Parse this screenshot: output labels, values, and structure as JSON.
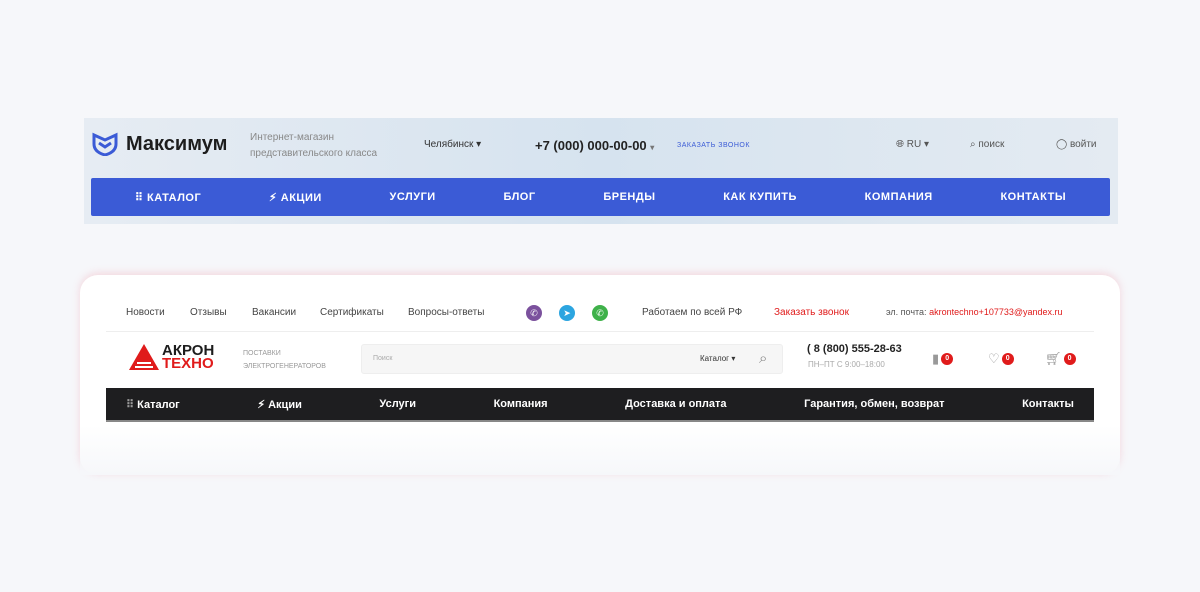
{
  "maximum": {
    "logo": "Максимум",
    "tagline": [
      "Интернет-магазин",
      "представительского класса"
    ],
    "city": "Челябинск",
    "phone": "+7 (000) 000-00-00",
    "callback": "ЗАКАЗАТЬ ЗВОНОК",
    "lang": "RU",
    "search": "поиск",
    "login": "войти",
    "nav": [
      "КАТАЛОГ",
      "АКЦИИ",
      "УСЛУГИ",
      "БЛОГ",
      "БРЕНДЫ",
      "КАК КУПИТЬ",
      "КОМПАНИЯ",
      "КОНТАКТЫ"
    ],
    "accent": "#3b5bd6"
  },
  "akron": {
    "top_links": [
      "Новости",
      "Отзывы",
      "Вакансии",
      "Сертификаты",
      "Вопросы-ответы"
    ],
    "region": "Работаем по всей РФ",
    "callback": "Заказать звонок",
    "email_label": "эл. почта:",
    "email": "akrontechno+107733@yandex.ru",
    "logo": [
      "АКРОН",
      "ТЕХНО"
    ],
    "tagline": [
      "ПОСТАВКИ",
      "ЭЛЕКТРОГЕНЕРАТОРОВ"
    ],
    "search_placeholder": "Поиск",
    "search_catalog": "Каталог",
    "phone": "8 (800) 555-28-63",
    "hours": "ПН–ПТ С 9:00–18:00",
    "compare_count": "0",
    "favorites_count": "0",
    "cart_count": "0",
    "nav": [
      "Каталог",
      "Акции",
      "Услуги",
      "Компания",
      "Доставка и оплата",
      "Гарантия, обмен, возврат",
      "Контакты"
    ],
    "accent": "#e01b1b"
  }
}
